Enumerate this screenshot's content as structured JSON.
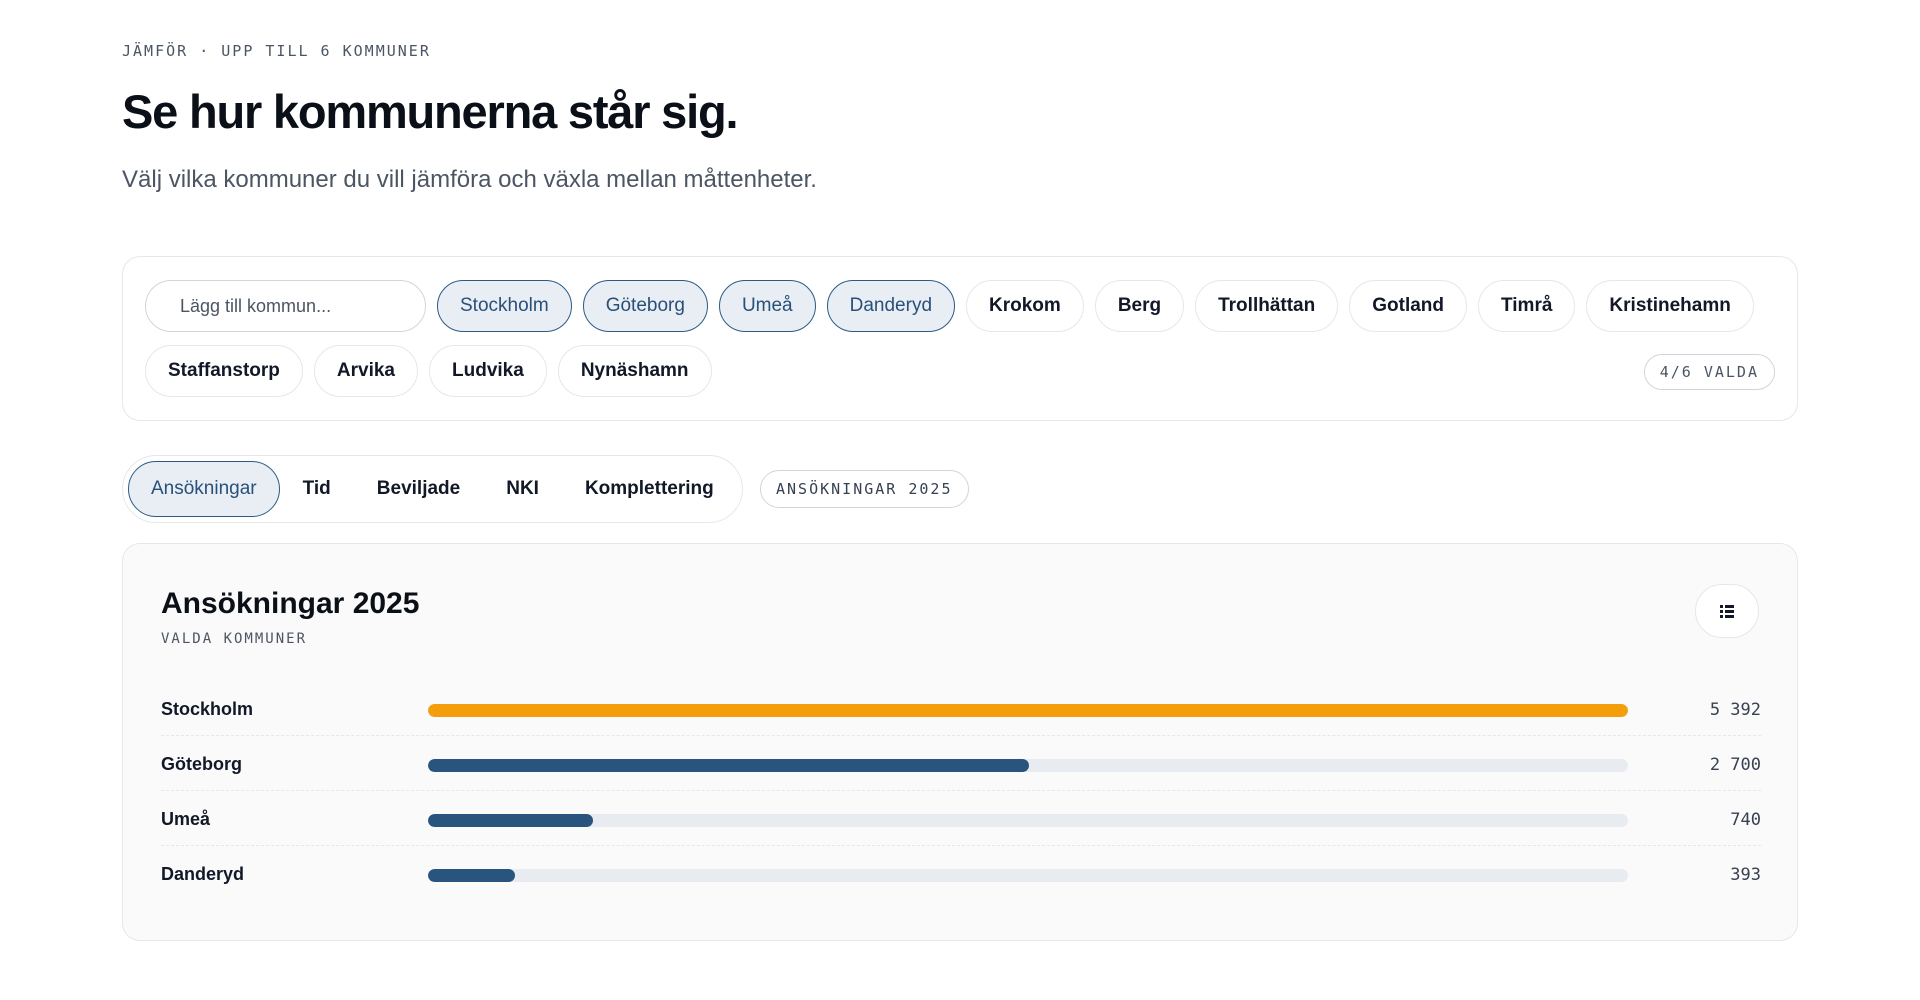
{
  "header": {
    "eyebrow": "JÄMFÖR · UPP TILL 6 KOMMUNER",
    "title": "Se hur kommunerna står sig.",
    "subtitle": "Välj vilka kommuner du vill jämföra och växla mellan måttenheter."
  },
  "picker": {
    "search_placeholder": "Lägg till kommun...",
    "row1": [
      {
        "label": "Stockholm",
        "selected": true
      },
      {
        "label": "Göteborg",
        "selected": true
      },
      {
        "label": "Umeå",
        "selected": true
      },
      {
        "label": "Danderyd",
        "selected": true
      },
      {
        "label": "Krokom",
        "selected": false
      },
      {
        "label": "Berg",
        "selected": false
      },
      {
        "label": "Trollhättan",
        "selected": false
      },
      {
        "label": "Gotland",
        "selected": false
      },
      {
        "label": "Timrå",
        "selected": false
      },
      {
        "label": "Kristinehamn",
        "selected": false
      }
    ],
    "row2": [
      {
        "label": "Staffanstorp",
        "selected": false
      },
      {
        "label": "Arvika",
        "selected": false
      },
      {
        "label": "Ludvika",
        "selected": false
      },
      {
        "label": "Nynäshamn",
        "selected": false
      }
    ],
    "count_badge": "4/6 VALDA"
  },
  "tabs": {
    "items": [
      {
        "label": "Ansökningar",
        "active": true
      },
      {
        "label": "Tid",
        "active": false
      },
      {
        "label": "Beviljade",
        "active": false
      },
      {
        "label": "NKI",
        "active": false
      },
      {
        "label": "Komplettering",
        "active": false
      }
    ],
    "metric_badge": "ANSÖKNINGAR 2025"
  },
  "card": {
    "title": "Ansökningar 2025",
    "subtitle": "VALDA KOMMUNER",
    "view_icon": "list-icon"
  },
  "colors": {
    "highlight": "#f59e0b",
    "bar": "#28547d",
    "track": "#e8ecf0",
    "selected_fill": "#e8eef4",
    "selected_border": "#2b5b85"
  },
  "chart_data": {
    "type": "bar",
    "orientation": "horizontal",
    "categories": [
      "Stockholm",
      "Göteborg",
      "Umeå",
      "Danderyd"
    ],
    "values": [
      5392,
      2700,
      740,
      393
    ],
    "value_labels": [
      "5 392",
      "2 700",
      "740",
      "393"
    ],
    "highlight_index": 0,
    "xlim": [
      0,
      5392
    ],
    "grid": false,
    "legend": "none"
  }
}
